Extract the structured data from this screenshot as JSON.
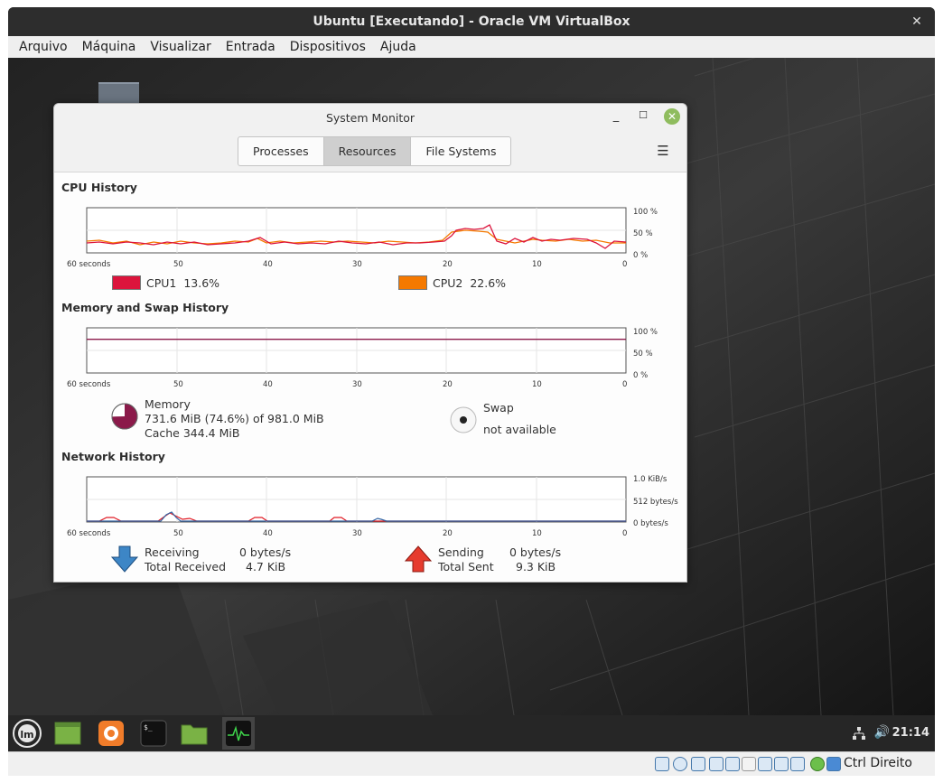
{
  "vbox": {
    "title": "Ubuntu [Executando] - Oracle VM VirtualBox",
    "menu": [
      "Arquivo",
      "Máquina",
      "Visualizar",
      "Entrada",
      "Dispositivos",
      "Ajuda"
    ],
    "host_key": "Ctrl Direito"
  },
  "sysmon": {
    "title": "System Monitor",
    "tabs": [
      {
        "label": "Processes",
        "active": false
      },
      {
        "label": "Resources",
        "active": true
      },
      {
        "label": "File Systems",
        "active": false
      }
    ],
    "x_ticks": [
      "60 seconds",
      "50",
      "40",
      "30",
      "20",
      "10",
      "0"
    ],
    "cpu": {
      "title": "CPU History",
      "y_ticks": [
        "100 %",
        "50 %",
        "0 %"
      ],
      "series": [
        {
          "name": "CPU1",
          "value": "13.6%",
          "color": "#dc143c"
        },
        {
          "name": "CPU2",
          "value": "22.6%",
          "color": "#f57900"
        }
      ]
    },
    "memory": {
      "title": "Memory and Swap History",
      "y_ticks": [
        "100 %",
        "50 %",
        "0 %"
      ],
      "memory_label": "Memory",
      "memory_used": "731.6 MiB (74.6%) of 981.0 MiB",
      "memory_cache": "Cache 344.4 MiB",
      "memory_percent": 74.6,
      "memory_color": "#8b1a4a",
      "swap_label": "Swap",
      "swap_status": "not available"
    },
    "network": {
      "title": "Network History",
      "y_ticks": [
        "1.0 KiB/s",
        "512 bytes/s",
        "0 bytes/s"
      ],
      "receiving_label": "Receiving",
      "receiving_value": "0 bytes/s",
      "total_received_label": "Total Received",
      "total_received_value": "4.7 KiB",
      "sending_label": "Sending",
      "sending_value": "0 bytes/s",
      "total_sent_label": "Total Sent",
      "total_sent_value": "9.3 KiB"
    }
  },
  "taskbar": {
    "clock": "21:14",
    "launchers": [
      "mint-menu-icon",
      "desktop-icon",
      "firefox-icon",
      "terminal-icon",
      "files-icon",
      "system-monitor-icon"
    ]
  }
}
